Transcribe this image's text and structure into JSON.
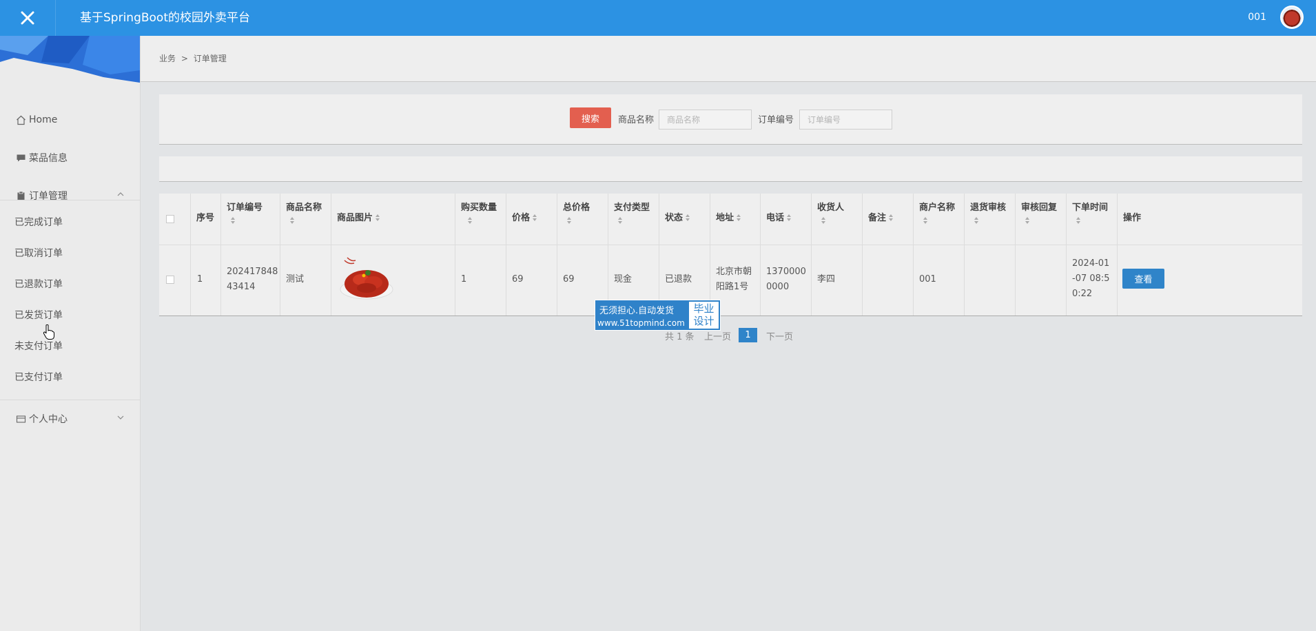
{
  "app": {
    "title": "基于SpringBoot的校园外卖平台",
    "user": "001"
  },
  "breadcrumb": {
    "root": "业务",
    "separator": ">",
    "current": "订单管理"
  },
  "sidebar": {
    "items": [
      {
        "label": "Home",
        "icon": "home-icon"
      },
      {
        "label": "菜品信息",
        "icon": "chat-icon"
      },
      {
        "label": "订单管理",
        "icon": "clipboard-icon"
      }
    ],
    "order_sub": [
      "已完成订单",
      "已取消订单",
      "已退款订单",
      "已发货订单",
      "未支付订单",
      "已支付订单"
    ],
    "personal": {
      "label": "个人中心",
      "icon": "card-icon"
    }
  },
  "search": {
    "button": "搜索",
    "name_label": "商品名称",
    "name_placeholder": "商品名称",
    "no_label": "订单编号",
    "no_placeholder": "订单编号"
  },
  "table": {
    "headers": [
      "序号",
      "订单编号",
      "商品名称",
      "商品图片",
      "购买数量",
      "价格",
      "总价格",
      "支付类型",
      "状态",
      "地址",
      "电话",
      "收货人",
      "备注",
      "商户名称",
      "退货审核",
      "审核回复",
      "下单时间",
      "操作"
    ],
    "row": {
      "index": "1",
      "order_no_1": "202417848",
      "order_no_2": "43414",
      "name": "测试",
      "qty": "1",
      "price": "69",
      "total": "69",
      "pay_type": "现金",
      "status": "已退款",
      "addr_1": "北京市朝",
      "addr_2": "阳路1号",
      "phone_1": "1370000",
      "phone_2": "0000",
      "receiver": "李四",
      "remark": "",
      "merchant": "001",
      "return_audit": "",
      "audit_reply": "",
      "time_1": "2024-01",
      "time_2": "-07 08:5",
      "time_3": "0:22",
      "action": "查看"
    }
  },
  "pagination": {
    "total": "共 1 条",
    "prev": "上一页",
    "page": "1",
    "next": "下一页"
  },
  "watermark": {
    "line1": "无须担心.自动发货",
    "line2": "www.51topmind.com",
    "badge1": "毕业",
    "badge2": "设计"
  },
  "colors": {
    "topbar": "#2c92e3",
    "search_button": "#e35f4f",
    "primary_button": "#2f84c9"
  }
}
